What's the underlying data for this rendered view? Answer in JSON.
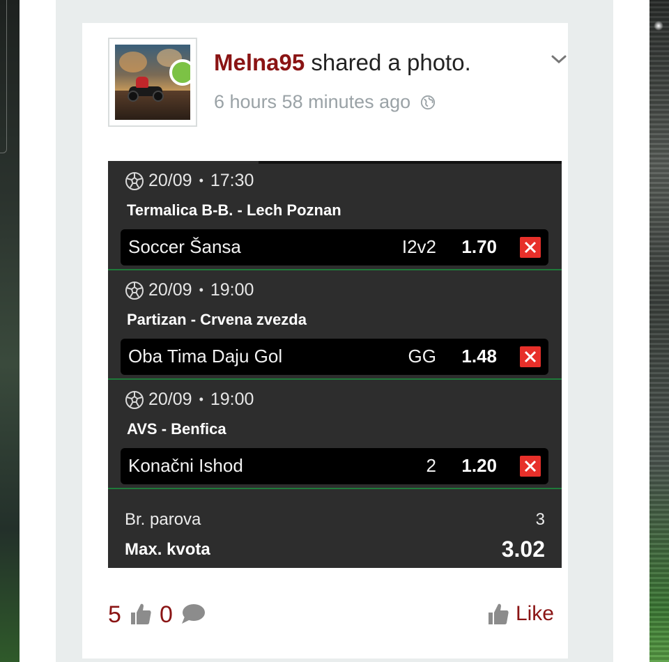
{
  "post": {
    "username": "Melna95",
    "action": " shared a photo.",
    "time_ago": "6 hours 58 minutes ago"
  },
  "bet_slip": {
    "matches": [
      {
        "date": "20/09",
        "time": "17:30",
        "teams": "Termalica B-B. - Lech Poznan",
        "market": "Soccer Šansa",
        "pick": "I2v2",
        "odd": "1.70"
      },
      {
        "date": "20/09",
        "time": "19:00",
        "teams": "Partizan - Crvena zvezda",
        "market": "Oba Tima Daju Gol",
        "pick": "GG",
        "odd": "1.48"
      },
      {
        "date": "20/09",
        "time": "19:00",
        "teams": "AVS - Benfica",
        "market": "Konačni Ishod",
        "pick": "2",
        "odd": "1.20"
      }
    ],
    "separator_dot": "•",
    "pairs_label": "Br. parova",
    "pairs_value": "3",
    "max_odd_label": "Max. kvota",
    "max_odd_value": "3.02"
  },
  "footer": {
    "likes_count": "5",
    "comments_count": "0",
    "like_label": "Like"
  },
  "colors": {
    "username": "#8a1414",
    "online": "#7cc245",
    "remove": "#e7302a",
    "separator": "#1f7a3a"
  },
  "icons": [
    "chevron-down-icon",
    "globe-icon",
    "soccer-ball-icon",
    "close-icon",
    "thumbs-up-icon",
    "comment-bubble-icon"
  ]
}
